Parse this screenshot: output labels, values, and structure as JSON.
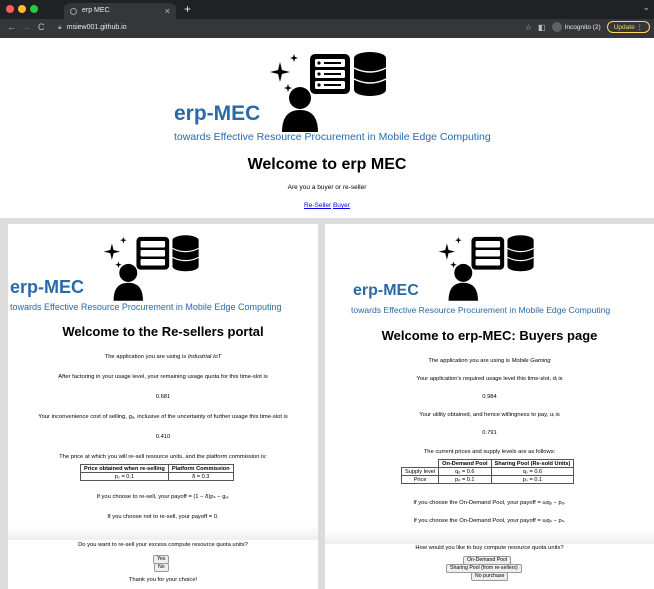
{
  "browser": {
    "tab_title": "erp MEC",
    "tab_close": "×",
    "new_tab": "+",
    "url": "msiew001.github.io",
    "incognito_label": "Incognito (2)",
    "update_label": "Update",
    "nav_back": "←",
    "nav_forward": "→",
    "nav_reload": "C",
    "bookmark_icon": "☆",
    "menu_chevron": "⌄"
  },
  "landing": {
    "brand": "erp-MEC",
    "tagline": "towards Effective Resource Procurement in Mobile Edge Computing",
    "heading": "Welcome to erp MEC",
    "prompt": "Are you a buyer or re-seller",
    "link_reseller": "Re-Seller",
    "link_buyer": "Buyer"
  },
  "reseller": {
    "brand": "erp-MEC",
    "tagline": "towards Effective Resource Procurement in Mobile Edge Computing",
    "heading": "Welcome to the Re-sellers portal",
    "app_prefix": "The application you are using is ",
    "app_name": "Industrial IoT",
    "usage_text": "After factoring in your usage level, your remaining usage quota for this time-slot is",
    "usage_value": "0.681",
    "cost_text": "Your inconvenience cost of selling, gᵤ, inclusive of the uncertainty of further usage this time-slot is",
    "cost_value": "0.410",
    "price_text": "The price at which you will re-sell resource units, and the platform commission is:",
    "table_headers": [
      "Price obtained when re-selling",
      "Platform Commission"
    ],
    "table_row": [
      "pₛ = 0.1",
      "δ = 0.3"
    ],
    "resell_payoff": "If you choose to re-sell, your payoff = (1 − δ)pₛ − gᵤ.",
    "noresell_payoff": "If you choose not to re-sell, your payoff = 0.",
    "question": "Do you want to re-sell your excess compute resource quota units?",
    "btn_yes": "Yes",
    "btn_no": "No",
    "thanks": "Thank you for your choice!"
  },
  "buyer": {
    "brand": "erp-MEC",
    "tagline": "towards Effective Resource Procurement in Mobile Edge Computing",
    "heading": "Welcome to erp-MEC: Buyers page",
    "app_prefix": "The application you are using is ",
    "app_name": "Mobile Gaming",
    "usage_text": "Your application's required usage level this time-slot, dᵢ is",
    "usage_value": "0.984",
    "utility_text": "Your utility obtained, and hence willingness to pay, uᵢ is",
    "utility_value": "0.791",
    "prices_text": "The current prices and supply levels are as follows:",
    "table_headers": [
      "",
      "On-Demand Pool",
      "Sharing Pool (Re-sold Units)"
    ],
    "table_rows": [
      [
        "Supply level",
        "qₒ = 0.6",
        "qₛ = 0.6"
      ],
      [
        "Price",
        "pₒ = 0.1",
        "pₛ = 0.1"
      ]
    ],
    "ondemand_payoff": "If you choose the On-Demand Pool, your payoff = uᵢqₒ − pₒ.",
    "sharing_payoff": "If you choose the On-Demand Pool, your payoff = uᵢqₛ − pₛ.",
    "question": "How would you like to buy compute resource quota units?",
    "btn_ondemand": "On-Demand Pool",
    "btn_sharing": "Sharing Pool (from re-sellers)",
    "btn_none": "No purchase"
  }
}
